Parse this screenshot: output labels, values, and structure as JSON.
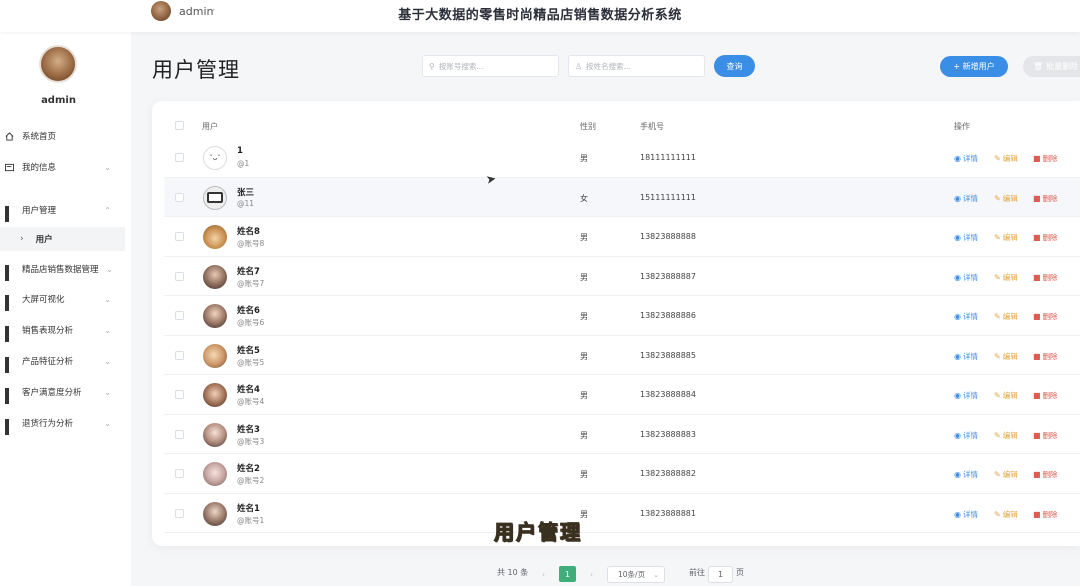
{
  "header": {
    "username": "admin",
    "system_title": "基于大数据的零售时尚精品店销售数据分析系统"
  },
  "sidebar": {
    "username": "admin",
    "items": [
      {
        "label": "系统首页"
      },
      {
        "label": "我的信息"
      },
      {
        "label": "用户管理"
      },
      {
        "label": "用户"
      },
      {
        "label": "精品店销售数据管理"
      },
      {
        "label": "大屏可视化"
      },
      {
        "label": "销售表现分析"
      },
      {
        "label": "产品特征分析"
      },
      {
        "label": "客户满意度分析"
      },
      {
        "label": "退货行为分析"
      }
    ]
  },
  "page": {
    "title": "用户管理",
    "search_account_placeholder": "按账号搜索...",
    "search_name_placeholder": "按姓名搜索...",
    "query_label": "查询",
    "add_label": "+ 新增用户",
    "batch_delete_label": "批量删除"
  },
  "table": {
    "headers": {
      "user": "用户",
      "gender": "性别",
      "phone": "手机号",
      "actions": "操作"
    },
    "action_labels": {
      "detail": "详情",
      "edit": "编辑",
      "delete": "删除"
    },
    "rows": [
      {
        "name": "1",
        "account": "@1",
        "gender": "男",
        "phone": "18111111111"
      },
      {
        "name": "张三",
        "account": "@11",
        "gender": "女",
        "phone": "15111111111"
      },
      {
        "name": "姓名8",
        "account": "@账号8",
        "gender": "男",
        "phone": "13823888888"
      },
      {
        "name": "姓名7",
        "account": "@账号7",
        "gender": "男",
        "phone": "13823888887"
      },
      {
        "name": "姓名6",
        "account": "@账号6",
        "gender": "男",
        "phone": "13823888886"
      },
      {
        "name": "姓名5",
        "account": "@账号5",
        "gender": "男",
        "phone": "13823888885"
      },
      {
        "name": "姓名4",
        "account": "@账号4",
        "gender": "男",
        "phone": "13823888884"
      },
      {
        "name": "姓名3",
        "account": "@账号3",
        "gender": "男",
        "phone": "13823888883"
      },
      {
        "name": "姓名2",
        "account": "@账号2",
        "gender": "男",
        "phone": "13823888882"
      },
      {
        "name": "姓名1",
        "account": "@账号1",
        "gender": "男",
        "phone": "13823888881"
      }
    ]
  },
  "pagination": {
    "total": "共 10 条",
    "current_page": "1",
    "page_size": "10条/页",
    "goto_label": "前往",
    "goto_value": "1",
    "page_suffix": "页"
  },
  "watermark": "用户管理",
  "colors": {
    "primary": "#3a8ee6",
    "edit": "#e6a23c",
    "delete": "#e05a4f",
    "pager_active": "#3fae7a"
  }
}
